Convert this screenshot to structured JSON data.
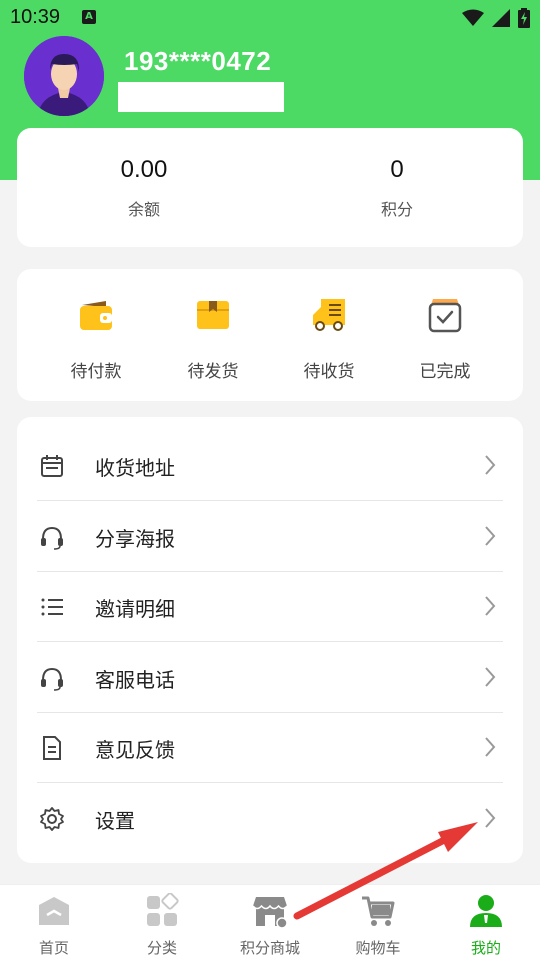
{
  "status_bar": {
    "time": "10:39",
    "notification_glyph": "A"
  },
  "profile": {
    "phone": "193****0472"
  },
  "stats": [
    {
      "value": "0.00",
      "label": "余额"
    },
    {
      "value": "0",
      "label": "积分"
    }
  ],
  "orders": [
    {
      "label": "待付款",
      "icon": "wallet-icon"
    },
    {
      "label": "待发货",
      "icon": "box-icon"
    },
    {
      "label": "待收货",
      "icon": "truck-icon"
    },
    {
      "label": "已完成",
      "icon": "completed-icon"
    }
  ],
  "menu": [
    {
      "label": "收货地址",
      "icon": "calendar-icon"
    },
    {
      "label": "分享海报",
      "icon": "headset-icon"
    },
    {
      "label": "邀请明细",
      "icon": "list-icon"
    },
    {
      "label": "客服电话",
      "icon": "headset-icon"
    },
    {
      "label": "意见反馈",
      "icon": "document-icon"
    },
    {
      "label": "设置",
      "icon": "gear-icon"
    }
  ],
  "tabs": [
    {
      "label": "首页",
      "icon": "home-icon"
    },
    {
      "label": "分类",
      "icon": "category-icon"
    },
    {
      "label": "积分商城",
      "icon": "store-icon"
    },
    {
      "label": "购物车",
      "icon": "cart-icon"
    },
    {
      "label": "我的",
      "icon": "user-icon",
      "active": true
    }
  ],
  "colors": {
    "accent_green": "#4cd964",
    "active_tab": "#1aad19",
    "order_icon_yellow": "#ffc21a",
    "annotation_arrow": "#e53935"
  }
}
